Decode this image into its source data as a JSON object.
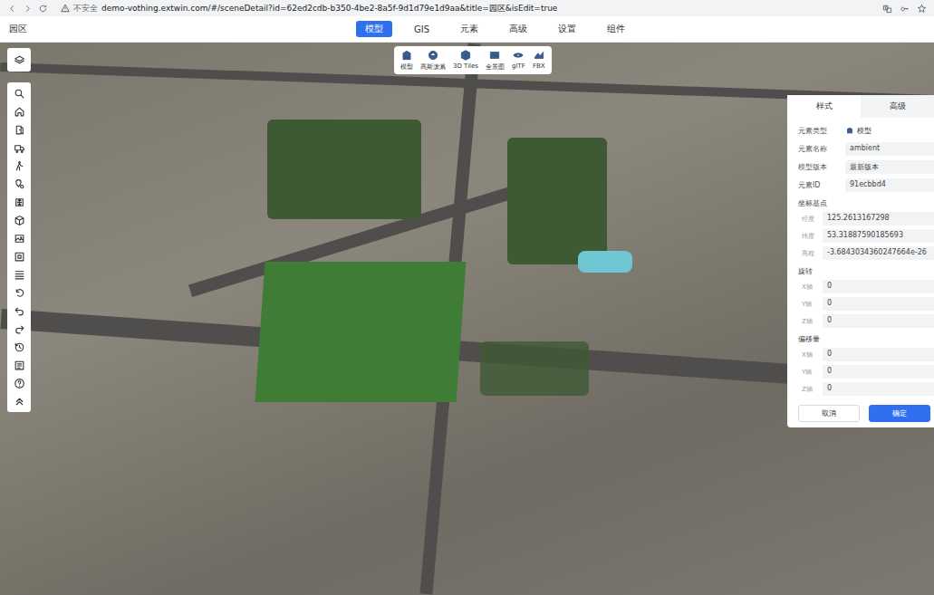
{
  "browser": {
    "security": "不安全",
    "url": "demo-vothing.extwin.com/#/sceneDetail?id=62ed2cdb-b350-4be2-8a5f-9d1d79e1d9aa&title=园区&isEdit=true"
  },
  "header": {
    "title": "园区",
    "tabs": [
      {
        "label": "模型",
        "selected": true
      },
      {
        "label": "GIS",
        "selected": false
      },
      {
        "label": "元素",
        "selected": false
      },
      {
        "label": "高级",
        "selected": false
      },
      {
        "label": "设置",
        "selected": false
      },
      {
        "label": "组件",
        "selected": false
      }
    ]
  },
  "model_toolbar": {
    "items": [
      {
        "label": "模型"
      },
      {
        "label": "高斯泼溅"
      },
      {
        "label": "3D Tiles"
      },
      {
        "label": "全景图"
      },
      {
        "label": "glTF"
      },
      {
        "label": "FBX"
      }
    ]
  },
  "panel": {
    "tabs": [
      {
        "label": "样式",
        "selected": true
      },
      {
        "label": "高级",
        "selected": false
      }
    ],
    "fields": [
      {
        "label": "元素类型",
        "value": "模型",
        "kind": "type"
      },
      {
        "label": "元素名称",
        "value": "ambient",
        "kind": "box"
      },
      {
        "label": "模型版本",
        "value": "最新版本",
        "kind": "box"
      },
      {
        "label": "元素ID",
        "value": "91ecbbd4",
        "kind": "box"
      }
    ],
    "sections": [
      {
        "title": "坐标基点",
        "fields": [
          {
            "label": "经度",
            "value": "125.2613167298"
          },
          {
            "label": "纬度",
            "value": "53.31887590185693"
          },
          {
            "label": "高程",
            "value": "-3.6843034360247664e-26"
          }
        ]
      },
      {
        "title": "旋转",
        "fields": [
          {
            "label": "X轴",
            "value": "0"
          },
          {
            "label": "Y轴",
            "value": "0"
          },
          {
            "label": "Z轴",
            "value": "0"
          }
        ]
      },
      {
        "title": "偏移量",
        "fields": [
          {
            "label": "X轴",
            "value": "0"
          },
          {
            "label": "Y轴",
            "value": "0"
          },
          {
            "label": "Z轴",
            "value": "0"
          }
        ]
      }
    ],
    "buttons": [
      {
        "label": "取消",
        "primary": false
      },
      {
        "label": "确定",
        "primary": true
      }
    ]
  }
}
